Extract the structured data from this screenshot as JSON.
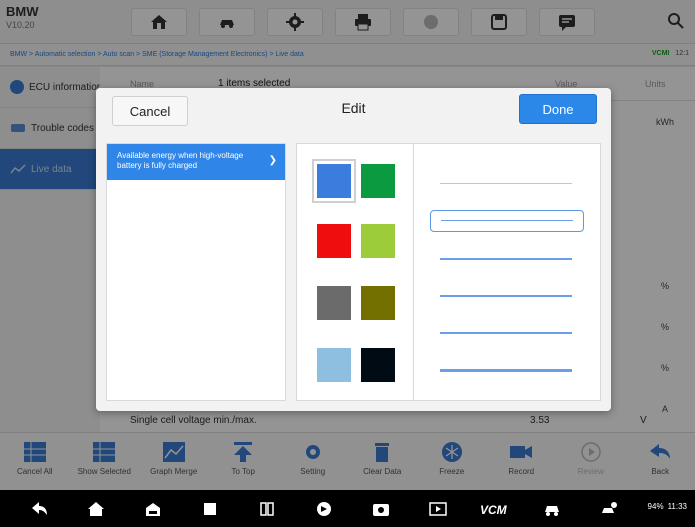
{
  "header": {
    "make": "BMW",
    "vin_label": "V10.20",
    "nav_icons": [
      "home-icon",
      "vehicle-swap-icon",
      "settings-icon",
      "print-icon",
      "help-icon",
      "save-icon",
      "message-icon"
    ],
    "search_icon": "search-icon"
  },
  "breadcrumb": {
    "path": "BMW > Automatic selection > Auto scan > SME (Storage Management Electronics) > Live data",
    "vcm_label": "VCMI",
    "time": "12:1"
  },
  "sidebar": {
    "items": [
      {
        "label": "ECU information",
        "icon": "info-icon"
      },
      {
        "label": "Trouble codes",
        "icon": "trouble-code-icon"
      },
      {
        "label": "Live data",
        "icon": "live-data-icon"
      }
    ]
  },
  "table": {
    "col_name": "Name",
    "selection_text": "1 items selected",
    "col_value": "Value",
    "col_units": "Units",
    "units": [
      "kWh",
      "",
      "",
      "",
      "%",
      "%",
      "%",
      "A"
    ],
    "last_row": {
      "name": "Single cell voltage min./max.",
      "value": "3.53",
      "unit": "V"
    }
  },
  "dialog": {
    "cancel_label": "Cancel",
    "title": "Edit",
    "done_label": "Done",
    "item_label": "Available energy when high-voltage battery is fully charged",
    "colors": [
      "#3b7ddd",
      "#0c9a40",
      "#ef0e0e",
      "#9dcc3a",
      "#6b6b6b",
      "#737000",
      "#8fbfe0",
      "#000b14"
    ],
    "selected_color": "#3b7ddd",
    "line_styles": [
      "thin",
      "selected",
      "medium",
      "medium",
      "medium",
      "thick"
    ],
    "line_color": "#6a9ee8"
  },
  "toolbar": {
    "cancel_all": "Cancel All",
    "show_selected": "Show Selected",
    "graph_merge": "Graph Merge",
    "to_top": "To Top",
    "setting": "Setting",
    "clear_data": "Clear Data",
    "freeze": "Freeze",
    "record": "Record",
    "review": "Review",
    "back": "Back"
  },
  "system": {
    "battery": "94%",
    "clock": "11:33"
  }
}
